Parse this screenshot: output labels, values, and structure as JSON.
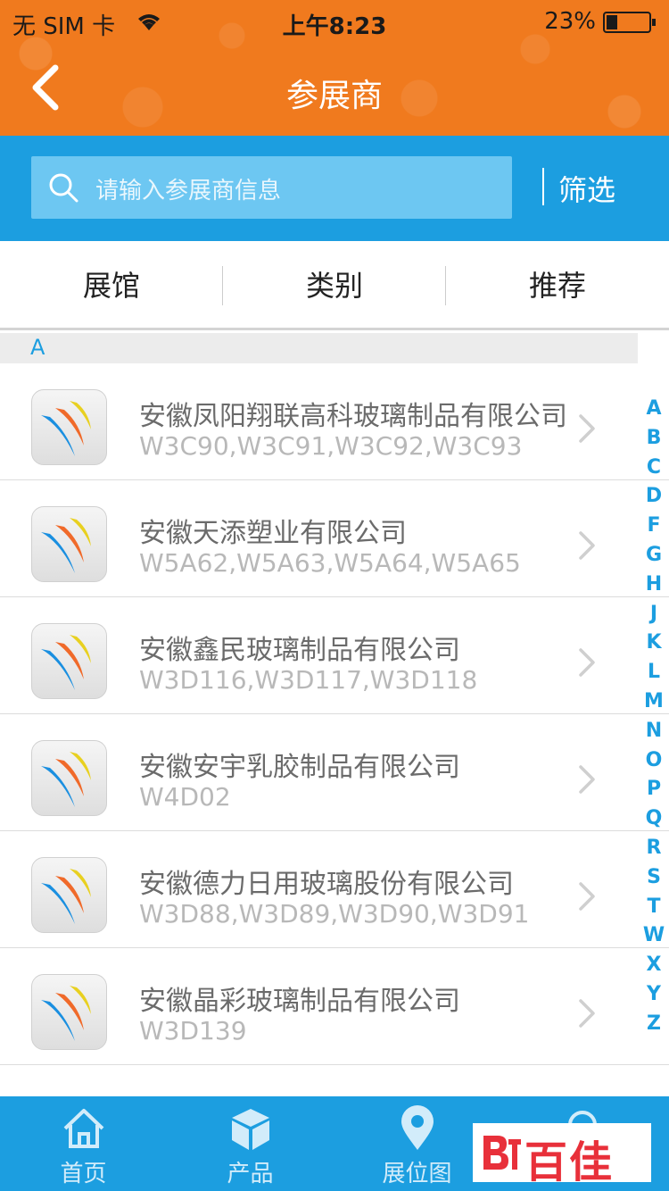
{
  "status_bar": {
    "carrier": "无 SIM 卡",
    "time": "上午8:23",
    "battery": "23%"
  },
  "header": {
    "title": "参展商",
    "back_icon": "chevron-left-icon",
    "color": "#f07a1e"
  },
  "search": {
    "placeholder": "请输入参展商信息",
    "filter_label": "筛选",
    "band_color": "#1c9ee0"
  },
  "tabs": [
    {
      "label": "展馆"
    },
    {
      "label": "类别"
    },
    {
      "label": "推荐"
    }
  ],
  "section": {
    "letter": "A"
  },
  "exhibitors": [
    {
      "name": "安徽凤阳翔联高科玻璃制品有限公司",
      "booths": "W3C90,W3C91,W3C92,W3C93"
    },
    {
      "name": "安徽天添塑业有限公司",
      "booths": "W5A62,W5A63,W5A64,W5A65"
    },
    {
      "name": "安徽鑫民玻璃制品有限公司",
      "booths": "W3D116,W3D117,W3D118"
    },
    {
      "name": "安徽安宇乳胶制品有限公司",
      "booths": "W4D02"
    },
    {
      "name": "安徽德力日用玻璃股份有限公司",
      "booths": "W3D88,W3D89,W3D90,W3D91"
    },
    {
      "name": "安徽晶彩玻璃制品有限公司",
      "booths": "W3D139"
    }
  ],
  "index_letters": [
    "A",
    "B",
    "C",
    "D",
    "F",
    "G",
    "H",
    "J",
    "K",
    "L",
    "M",
    "N",
    "O",
    "P",
    "Q",
    "R",
    "S",
    "T",
    "W",
    "X",
    "Y",
    "Z"
  ],
  "bottom_tabs": [
    {
      "label": "首页",
      "icon": "home-icon"
    },
    {
      "label": "产品",
      "icon": "cube-icon"
    },
    {
      "label": "展位图",
      "icon": "map-pin-icon"
    },
    {
      "label": "",
      "icon": "search-icon"
    }
  ],
  "watermark": {
    "text": "百佳"
  }
}
